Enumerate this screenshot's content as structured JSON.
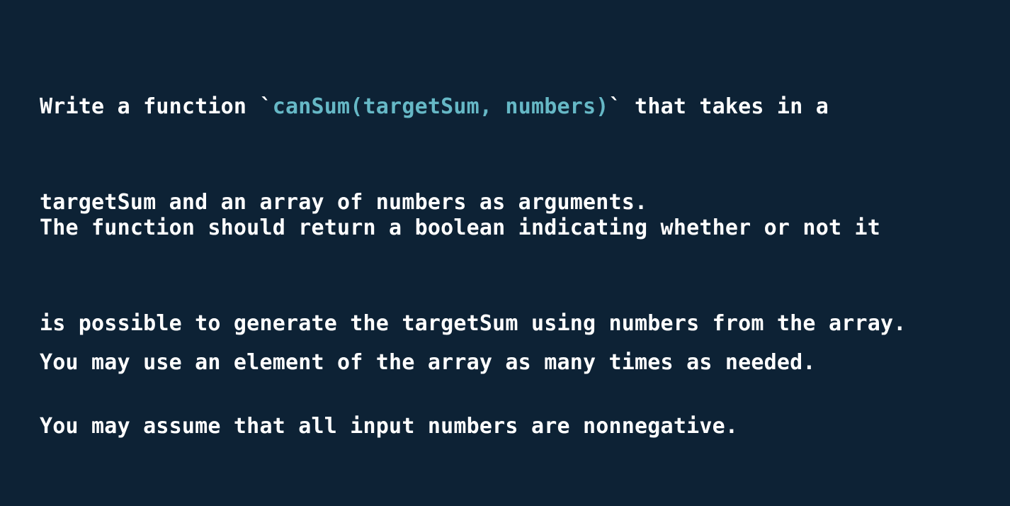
{
  "paragraphs": {
    "p1": {
      "line1_before": "Write a function `",
      "line1_code": "canSum(targetSum, numbers)",
      "line1_after": "` that takes in a",
      "line2": "targetSum and an array of numbers as arguments."
    },
    "p2": {
      "line1": "The function should return a boolean indicating whether or not it",
      "line2": "is possible to generate the targetSum using numbers from the array."
    },
    "p3": {
      "line1": "You may use an element of the array as many times as needed."
    },
    "p4": {
      "line1": "You may assume that all input numbers are nonnegative."
    }
  },
  "colors": {
    "background": "#0d2235",
    "text": "#ffffff",
    "code": "#66b8c6"
  }
}
